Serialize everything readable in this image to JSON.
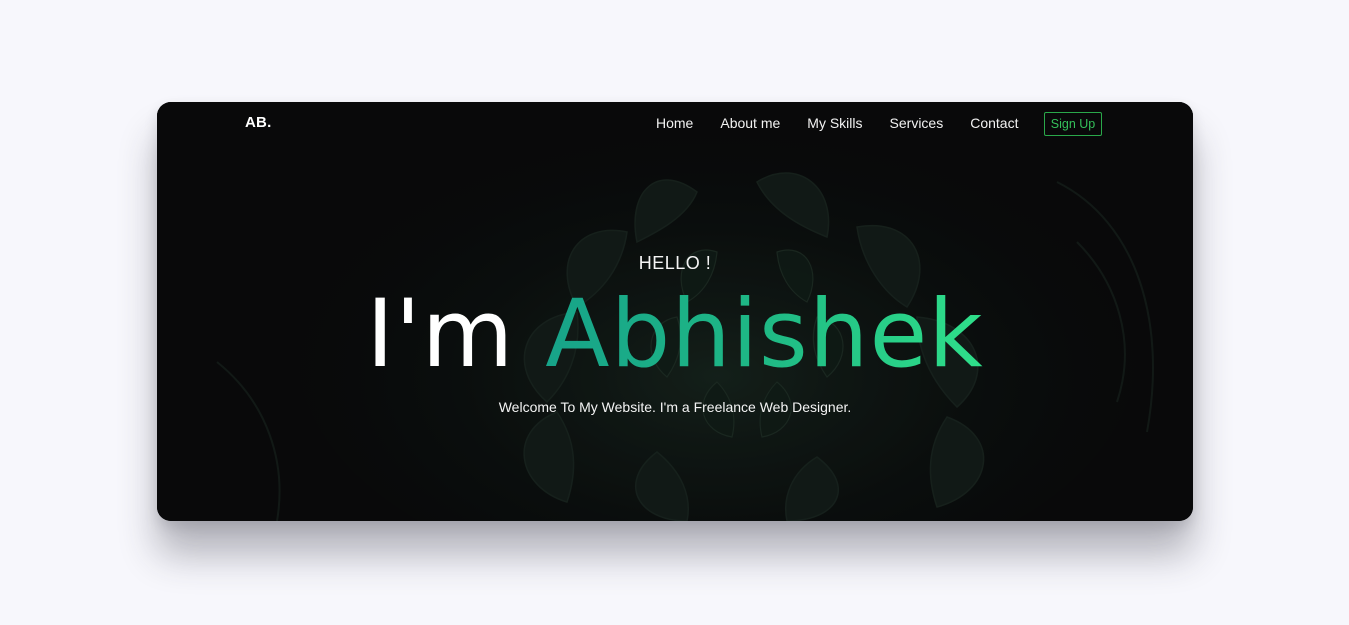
{
  "nav": {
    "logo": "AB.",
    "links": [
      "Home",
      "About me",
      "My Skills",
      "Services",
      "Contact"
    ],
    "signup": "Sign Up"
  },
  "hero": {
    "eyebrow": "HELLO !",
    "title_prefix": "I'm",
    "title_name": "Abhishek",
    "subtitle": "Welcome To My Website. I'm a Freelance Web Designer."
  },
  "colors": {
    "page_background": "#f7f7fc",
    "card_background": "#0b0c0d",
    "accent_start": "#17a389",
    "accent_end": "#2fe08a",
    "signup_border": "#2aa84a"
  }
}
